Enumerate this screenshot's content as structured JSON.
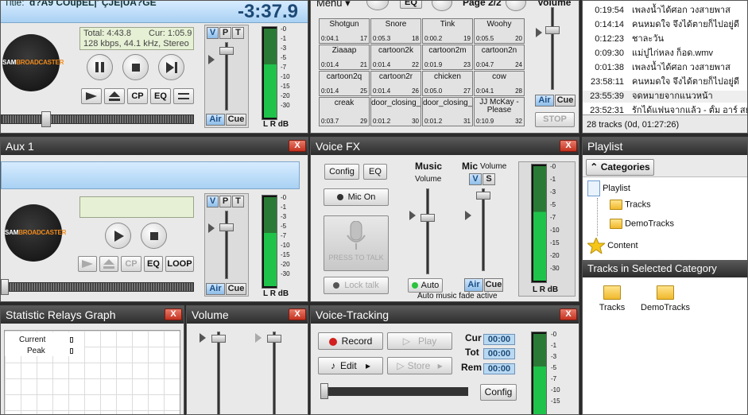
{
  "deck_a": {
    "title_label": "Title:",
    "title_value": "d?A9 COupEL|' ÇJE|UA?GE",
    "remaining": "-3:37.9",
    "total": "Total: 4:43.8",
    "cur": "Cur: 1:05.9",
    "format": "128 kbps, 44.1 kHz, Stereo",
    "logo_a": "SAM",
    "logo_b": "BROADCASTER",
    "btn_cp": "CP",
    "btn_eq": "EQ",
    "v": "V",
    "p": "P",
    "t": "T",
    "air": "Air",
    "cue": "Cue",
    "lr": "L R dB"
  },
  "scale_labels": [
    "-0",
    "-1",
    "-3",
    "-5",
    "-7",
    "-10",
    "-15",
    "-20",
    "-30"
  ],
  "carts": {
    "menu_label": "Menu",
    "eq_label": "EQ",
    "page_label": "Page 2/2",
    "volume_label": "Volume",
    "air": "Air",
    "cue": "Cue",
    "stop_label": "STOP",
    "cells": [
      {
        "name": "Shotgun",
        "dur": "0:04.1",
        "num": "17"
      },
      {
        "name": "Snore",
        "dur": "0:05.3",
        "num": "18"
      },
      {
        "name": "Tink",
        "dur": "0:00.2",
        "num": "19"
      },
      {
        "name": "Woohy",
        "dur": "0:05.5",
        "num": "20"
      },
      {
        "name": "Ziaaap",
        "dur": "0:01.4",
        "num": "21"
      },
      {
        "name": "cartoon2k",
        "dur": "0:01.4",
        "num": "22"
      },
      {
        "name": "cartoon2m",
        "dur": "0:01.9",
        "num": "23"
      },
      {
        "name": "cartoon2n",
        "dur": "0:04.7",
        "num": "24"
      },
      {
        "name": "cartoon2q",
        "dur": "0:01.4",
        "num": "25"
      },
      {
        "name": "cartoon2r",
        "dur": "0:01.4",
        "num": "26"
      },
      {
        "name": "chicken",
        "dur": "0:05.0",
        "num": "27"
      },
      {
        "name": "cow",
        "dur": "0:04.1",
        "num": "28"
      },
      {
        "name": "creak",
        "dur": "0:03.7",
        "num": "29"
      },
      {
        "name": "door_closing_2",
        "dur": "0:01.2",
        "num": "30"
      },
      {
        "name": "door_closing_3",
        "dur": "0:01.2",
        "num": "31"
      },
      {
        "name": "JJ McKay - Please",
        "dur": "0:10.9",
        "num": "32"
      }
    ]
  },
  "history": {
    "rows": [
      {
        "time": "0:19:54",
        "title": "เพลงน้ำได้ศอก วงสายพาส"
      },
      {
        "time": "0:14:14",
        "title": "คนหมดใจ จึงได้ตายก็ไปอยู่ดี"
      },
      {
        "time": "0:12:23",
        "title": "ชาละวัน"
      },
      {
        "time": "0:09:30",
        "title": "แม่ปูไก่หลง ก็อด.wmv"
      },
      {
        "time": "0:01:38",
        "title": "เพลงน้ำได้ศอก วงสายพาส"
      },
      {
        "time": "23:58:11",
        "title": "คนหมดใจ จึงได้ตายก็ไปอยู่ดี"
      },
      {
        "time": "23:55:39",
        "title": "จดหมายจากแนวหน้า"
      },
      {
        "time": "23:52:31",
        "title": "รักได้แฟนจากแล้ว - ตั้ม อาร์ สยาม"
      }
    ],
    "status": "28 tracks (0d, 01:27:26)"
  },
  "aux1": {
    "title": "Aux 1",
    "close": "X",
    "logo_a": "SAM",
    "logo_b": "BROADCASTER",
    "btn_cp": "CP",
    "btn_eq": "EQ",
    "btn_loop": "LOOP",
    "v": "V",
    "p": "P",
    "t": "T",
    "air": "Air",
    "cue": "Cue",
    "lr": "L R dB"
  },
  "voicefx": {
    "title": "Voice FX",
    "close": "X",
    "config": "Config",
    "eq": "EQ",
    "mic_on": "Mic On",
    "press_to_talk": "PRESS TO TALK",
    "lock_talk": "Lock talk",
    "music": "Music",
    "music_volume": "Volume",
    "mic": "Mic",
    "mic_volume": "Volume",
    "v": "V",
    "s": "S",
    "auto": "Auto",
    "air": "Air",
    "cue": "Cue",
    "fade_status": "Auto music fade active",
    "lr": "L R dB"
  },
  "playlist": {
    "title": "Playlist",
    "categories_btn": "Categories",
    "tree": [
      {
        "label": "Playlist",
        "icon": "document-icon"
      },
      {
        "label": "Tracks",
        "icon": "folder-icon"
      },
      {
        "label": "DemoTracks",
        "icon": "folder-icon"
      },
      {
        "label": "Content",
        "icon": "star-icon"
      }
    ],
    "section2": "Tracks in Selected Category",
    "folders": [
      "Tracks",
      "DemoTracks"
    ]
  },
  "relays": {
    "title": "Statistic Relays Graph",
    "close": "X",
    "current": "Current",
    "peak": "Peak"
  },
  "volume_panel": {
    "title": "Volume",
    "close": "X"
  },
  "voicetracking": {
    "title": "Voice-Tracking",
    "close": "X",
    "record": "Record",
    "play": "Play",
    "edit": "Edit",
    "store": "Store",
    "config": "Config",
    "cur_label": "Cur",
    "tot_label": "Tot",
    "rem_label": "Rem",
    "cur_value": "00:00",
    "tot_value": "00:00",
    "rem_value": "00:00"
  },
  "colors": {
    "accent_blue": "#8fbde8",
    "meter_green": "#1fc34a",
    "close_red": "#c4321f",
    "logo_orange": "#f08a1c"
  }
}
